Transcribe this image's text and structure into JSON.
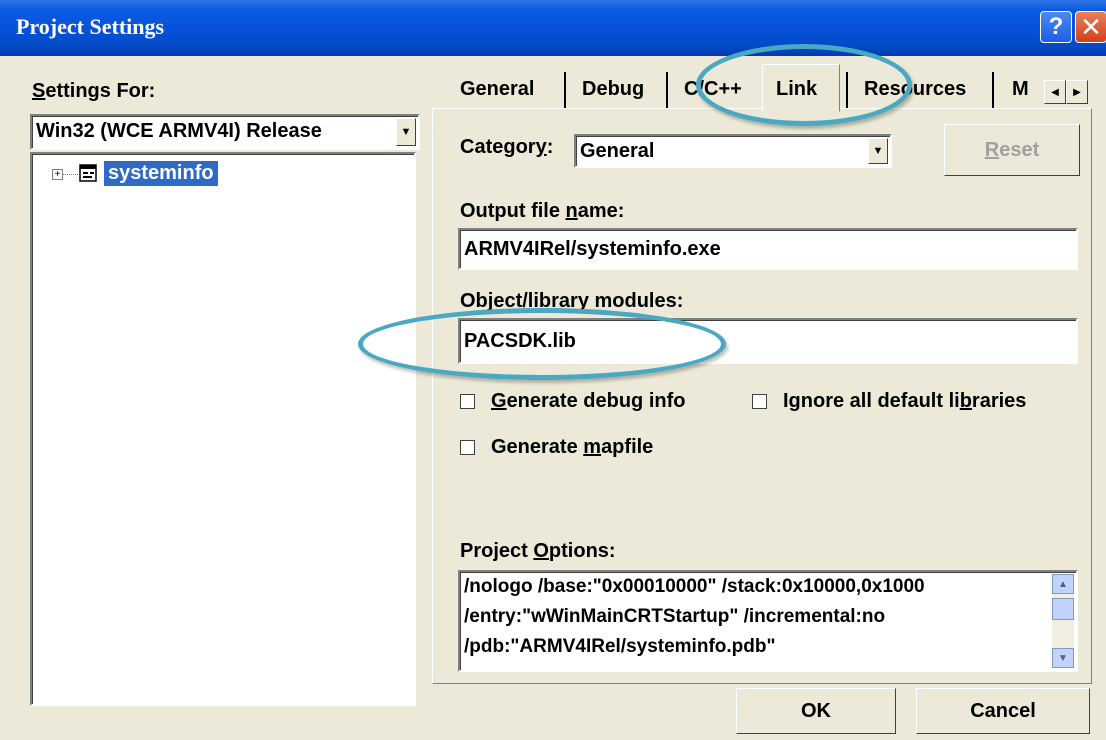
{
  "window": {
    "title": "Project Settings"
  },
  "titlebar": {
    "help_glyph": "?",
    "close_glyph": "✕"
  },
  "left": {
    "settings_for_prefix": "S",
    "settings_for_rest": "ettings For:",
    "config_value": "Win32 (WCE ARMV4I) Release",
    "tree_node": "systeminfo"
  },
  "tabs": [
    "General",
    "Debug",
    "C/C++",
    "Link",
    "Resources",
    "M"
  ],
  "active_tab": "Link",
  "category": {
    "label_main": "Categor",
    "label_u": "y",
    "label_end": ":",
    "value": "General"
  },
  "reset_label_u": "R",
  "reset_label_rest": "eset",
  "output_file": {
    "label_pre": "Output file ",
    "label_u": "n",
    "label_rest": "ame:",
    "value": "ARMV4IRel/systeminfo.exe"
  },
  "object_modules": {
    "label": "Object/library modules:",
    "value": "PACSDK.lib"
  },
  "checks": {
    "debug_u": "G",
    "debug_rest": "enerate debug info",
    "ignore_pre": "Ignore all default li",
    "ignore_u": "b",
    "ignore_rest": "raries",
    "map_pre": "Generate ",
    "map_u": "m",
    "map_rest": "apfile"
  },
  "project_options": {
    "label_pre": "Project ",
    "label_u": "O",
    "label_rest": "ptions:",
    "lines": [
      "/nologo /base:\"0x00010000\" /stack:0x10000,0x1000",
      "/entry:\"wWinMainCRTStartup\" /incremental:no",
      "/pdb:\"ARMV4IRel/systeminfo.pdb\""
    ]
  },
  "buttons": {
    "ok": "OK",
    "cancel": "Cancel"
  },
  "colors": {
    "highlight_ellipse": "#4aa8c2",
    "selection": "#316ac5",
    "titlebar": "#0552d8"
  }
}
